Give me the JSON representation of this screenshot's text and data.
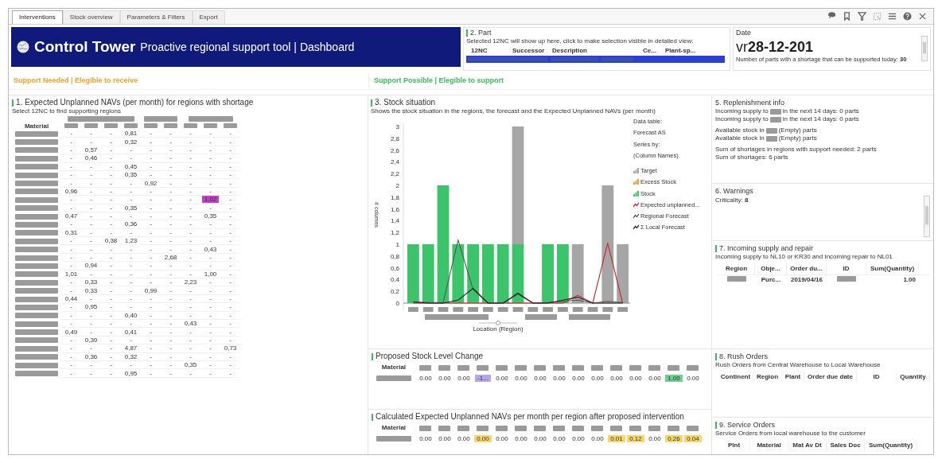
{
  "tabs": [
    {
      "label": "Interventions",
      "selected": true
    },
    {
      "label": "Stock overview",
      "selected": false
    },
    {
      "label": "Parameters & Filters",
      "selected": false
    },
    {
      "label": "Export",
      "selected": false
    }
  ],
  "banner": {
    "title": "Control Tower",
    "subtitle": "Proactive regional support tool | Dashboard"
  },
  "part_panel": {
    "title": "2. Part",
    "marker": true,
    "description": "Selected 12NC will show up here, click to make selection visible in detailed view:",
    "columns": [
      "12NC",
      "Successor",
      "Description",
      "Ce...",
      "Plant-sp..."
    ]
  },
  "date_panel": {
    "label": "Date",
    "value": "vr**28-12-201**",
    "note": "Number of parts with a shortage that can be supported today: **30**"
  },
  "section_headers": [
    {
      "text": "Support Needed | Elegible to receive",
      "color": "#f0a030"
    },
    {
      "text": "Support Possible | Elegible to support",
      "color": "#3cba5a"
    }
  ],
  "panel_1": {
    "title": "1. Expected Unplanned NAVs (per month) for regions with shortage",
    "marker": true,
    "subtitle": "Select 12NC to find supporting regions",
    "first_column": "Material",
    "rows": [
      [
        "-",
        "-",
        "-",
        "0,81",
        "-",
        "-",
        "-",
        "-",
        "-"
      ],
      [
        "-",
        "-",
        "-",
        "0,32",
        "-",
        "-",
        "-",
        "-",
        "-"
      ],
      [
        "-",
        "0,57",
        "-",
        "-",
        "-",
        "-",
        "-",
        "-",
        "-"
      ],
      [
        "-",
        "0,46",
        "-",
        "-",
        "-",
        "-",
        "-",
        "-",
        "-"
      ],
      [
        "-",
        "-",
        "-",
        "0,45",
        "-",
        "-",
        "-",
        "-",
        "-"
      ],
      [
        "-",
        "-",
        "-",
        "0,35",
        "-",
        "-",
        "-",
        "-",
        "-"
      ],
      [
        "-",
        "-",
        "-",
        "-",
        "0,92",
        "-",
        "-",
        "-",
        "-"
      ],
      [
        "0,96",
        "-",
        "-",
        "-",
        "-",
        "-",
        "-",
        "-",
        "-"
      ],
      [
        "-",
        "-",
        "-",
        "-",
        "-",
        "-",
        "-",
        {
          "text": "1,02",
          "color": "#c040c8"
        },
        "-"
      ],
      [
        "-",
        "-",
        "-",
        "0,35",
        "-",
        "-",
        "-",
        "-",
        "-"
      ],
      [
        "0,47",
        "-",
        "-",
        "-",
        "-",
        "-",
        "-",
        "0,35",
        "-"
      ],
      [
        "-",
        "-",
        "-",
        "0,36",
        "-",
        "-",
        "-",
        "-",
        "-"
      ],
      [
        "0,31",
        "-",
        "-",
        "-",
        "-",
        "-",
        "-",
        "-",
        "-"
      ],
      [
        "-",
        "-",
        "0,38",
        "1,23",
        "-",
        "-",
        "-",
        "-",
        "-"
      ],
      [
        "-",
        "-",
        "-",
        "-",
        "-",
        "-",
        "-",
        "0,43",
        "-"
      ],
      [
        "-",
        "-",
        "-",
        "-",
        "-",
        "2,68",
        "-",
        "-",
        "-"
      ],
      [
        "-",
        "0,94",
        "-",
        "-",
        "-",
        "-",
        "-",
        "-",
        "-"
      ],
      [
        "1,01",
        "-",
        "-",
        "-",
        "-",
        "-",
        "-",
        "1,00",
        "-"
      ],
      [
        "-",
        "0,33",
        "-",
        "-",
        "-",
        "-",
        "2,23",
        "-",
        "-"
      ],
      [
        "-",
        "0,33",
        "-",
        "-",
        "0,99",
        "-",
        "-",
        "-",
        "-"
      ],
      [
        "0,44",
        "-",
        "-",
        "-",
        "-",
        "-",
        "-",
        "-",
        "-"
      ],
      [
        "-",
        "0,95",
        "-",
        "-",
        "-",
        "-",
        "-",
        "-",
        "-"
      ],
      [
        "-",
        "-",
        "-",
        "0,40",
        "-",
        "-",
        "-",
        "-",
        "-"
      ],
      [
        "-",
        "-",
        "-",
        "-",
        "-",
        "-",
        "0,43",
        "-",
        "-"
      ],
      [
        "0,49",
        "-",
        "-",
        "0,41",
        "-",
        "-",
        "-",
        "-",
        "-"
      ],
      [
        "-",
        "0,39",
        "-",
        "-",
        "-",
        "-",
        "-",
        "-",
        "-"
      ],
      [
        "-",
        "-",
        "-",
        "4,87",
        "-",
        "-",
        "-",
        "-",
        "0,73"
      ],
      [
        "-",
        "0,36",
        "-",
        "0,32",
        "-",
        "-",
        "-",
        "-",
        "-"
      ],
      [
        "-",
        "-",
        "-",
        "-",
        "-",
        "-",
        "0,35",
        "-",
        "-"
      ],
      [
        "-",
        "-",
        "-",
        "0,95",
        "-",
        "-",
        "-",
        "-",
        "-"
      ]
    ]
  },
  "panel_3": {
    "title": "3. Stock situation",
    "marker": true,
    "subtitle": "Shows the stock situation in the regions, the forecast and the Expected Unplanned NAVs (per month)",
    "legend_header": [
      "Data table:",
      "Forecast AS",
      "Series by:",
      "(Column Names)"
    ],
    "chart_data": {
      "type": "bar",
      "stacked": true,
      "xlabel": "Location (Region)",
      "ylabel": "# columns",
      "ylim": [
        0,
        3
      ],
      "yticks": [
        0,
        {
          "value": 0.2,
          "label": "0,2"
        },
        {
          "value": 0.4,
          "label": "0,4"
        },
        {
          "value": 0.6,
          "label": "0,6"
        },
        {
          "value": 0.8,
          "label": "0,8"
        },
        1,
        {
          "value": 1.2,
          "label": "1,2"
        },
        {
          "value": 1.4,
          "label": "1,4"
        },
        {
          "value": 1.6,
          "label": "1,6"
        },
        {
          "value": 1.8,
          "label": "1,8"
        },
        2,
        {
          "value": 2.2,
          "label": "2,2"
        },
        {
          "value": 2.4,
          "label": "2,4"
        },
        {
          "value": 2.6,
          "label": "2,6"
        },
        {
          "value": 2.8,
          "label": "2,8"
        },
        3
      ],
      "series": [
        {
          "name": "Target",
          "type": "bar",
          "color": "#a6a6a6",
          "values": [
            null,
            null,
            null,
            null,
            null,
            null,
            null,
            2,
            null,
            null,
            null,
            1,
            null,
            2,
            1
          ]
        },
        {
          "name": "Excess Stock",
          "type": "bar",
          "color": "#f0a030",
          "values": [
            null,
            null,
            null,
            null,
            null,
            null,
            null,
            null,
            null,
            null,
            null,
            null,
            null,
            null,
            null
          ]
        },
        {
          "name": "Stock",
          "type": "bar",
          "color": "#3cc46a",
          "values": [
            1,
            1,
            2,
            1,
            1,
            1,
            1,
            1,
            null,
            1,
            1,
            null,
            null,
            null,
            null
          ]
        },
        {
          "name": "Expected unplanned...",
          "type": "line",
          "color": "#d02020",
          "values": [
            0,
            0,
            0,
            0,
            0,
            0,
            0,
            0,
            0,
            0,
            0,
            0.13,
            0,
            1.02,
            0
          ]
        },
        {
          "name": "Regional Forecast",
          "type": "line",
          "color": "#555555",
          "values": [
            0.02,
            0.01,
            0.01,
            1.07,
            0.23,
            0,
            0,
            0.15,
            0,
            0.01,
            0.03,
            0.05,
            0,
            0.03,
            0.01
          ]
        },
        {
          "name": "Σ Local Forecast",
          "type": "line",
          "color": "#222222",
          "values": [
            0.02,
            0,
            0,
            0.05,
            0.25,
            0,
            0,
            0.17,
            0,
            0,
            0.05,
            0.1,
            0,
            0,
            0
          ]
        }
      ]
    }
  },
  "panel_proposed": {
    "title": "Proposed Stock Level Change",
    "marker": true,
    "first_column": "Material",
    "row": [
      "0.00",
      "0.00",
      "0.00",
      {
        "text": "-1...",
        "color": "#b9a6ea"
      },
      "0.00",
      "0.00",
      "0.00",
      "0.00",
      "0.00",
      "0.00",
      "0.00",
      "0.00",
      "0.00",
      {
        "text": "1.00",
        "color": "#6fcf8f"
      },
      "0.00"
    ]
  },
  "panel_calculated": {
    "title": "Calculated Expected Unplanned NAVs per month per region after proposed intervention",
    "marker": true,
    "first_column": "Material",
    "row": [
      "0.00",
      "0.00",
      "0.00",
      {
        "text": "0.00",
        "color": "#f5d76e"
      },
      "0.00",
      "0.00",
      "0.00",
      "0.00",
      "0.00",
      "0.00",
      {
        "text": "0.01",
        "color": "#f5d76e"
      },
      {
        "text": "0.12",
        "color": "#f5d76e"
      },
      "0.00",
      {
        "text": "0.26",
        "color": "#f5d76e"
      },
      {
        "text": "0.04",
        "color": "#f5d76e"
      }
    ]
  },
  "panel_5": {
    "title": "5. Replenishment info",
    "marker": false,
    "groups": [
      [
        {
          "before": "Incoming supply to",
          "after": "in the next 14 days: 0 parts"
        },
        {
          "before": "Incoming supply to",
          "after": "in the next 14 days: 0 parts"
        }
      ],
      [
        {
          "before": "Available stock in",
          "after": "(Empty) parts"
        },
        {
          "before": "Available stock in",
          "after": "(Empty) parts"
        }
      ]
    ],
    "sums": [
      "Sum of shortages in regions with support needed: 2 parts",
      "Sum of shortages: 6 parts"
    ]
  },
  "panel_6": {
    "title": "6. Warnings",
    "marker": false,
    "text": "Criticality: **8**"
  },
  "panel_7": {
    "title": "7. Incoming supply and repair",
    "marker": true,
    "subtitle": "Incoming supply to NL10 or KR30 and Incoming repair to NL01",
    "columns": [
      "Region",
      "Obje...",
      "Order du...",
      "ID",
      "Sum(Quantity)"
    ],
    "rows": [
      [
        {
          "kind": "redacted"
        },
        {
          "kind": "text",
          "text": "Purc..."
        },
        {
          "kind": "text",
          "text": "2019/04/16"
        },
        {
          "kind": "redacted"
        },
        {
          "kind": "number",
          "text": "1.00"
        }
      ]
    ]
  },
  "panel_8": {
    "title": "8. Rush Orders",
    "marker": true,
    "subtitle": "Rush Orders from Central Warehouse to Local Warehouse",
    "columns": [
      "Continent",
      "Region",
      "Plant",
      "Order due date",
      "ID",
      "Quantity"
    ]
  },
  "panel_9": {
    "title": "9. Service Orders",
    "marker": true,
    "subtitle": "Service Orders from local warehouse to the customer",
    "columns": [
      "Plnt",
      "Material",
      "Mat Av Dt",
      "Sales Doc",
      "Sum(Quantity)"
    ]
  }
}
